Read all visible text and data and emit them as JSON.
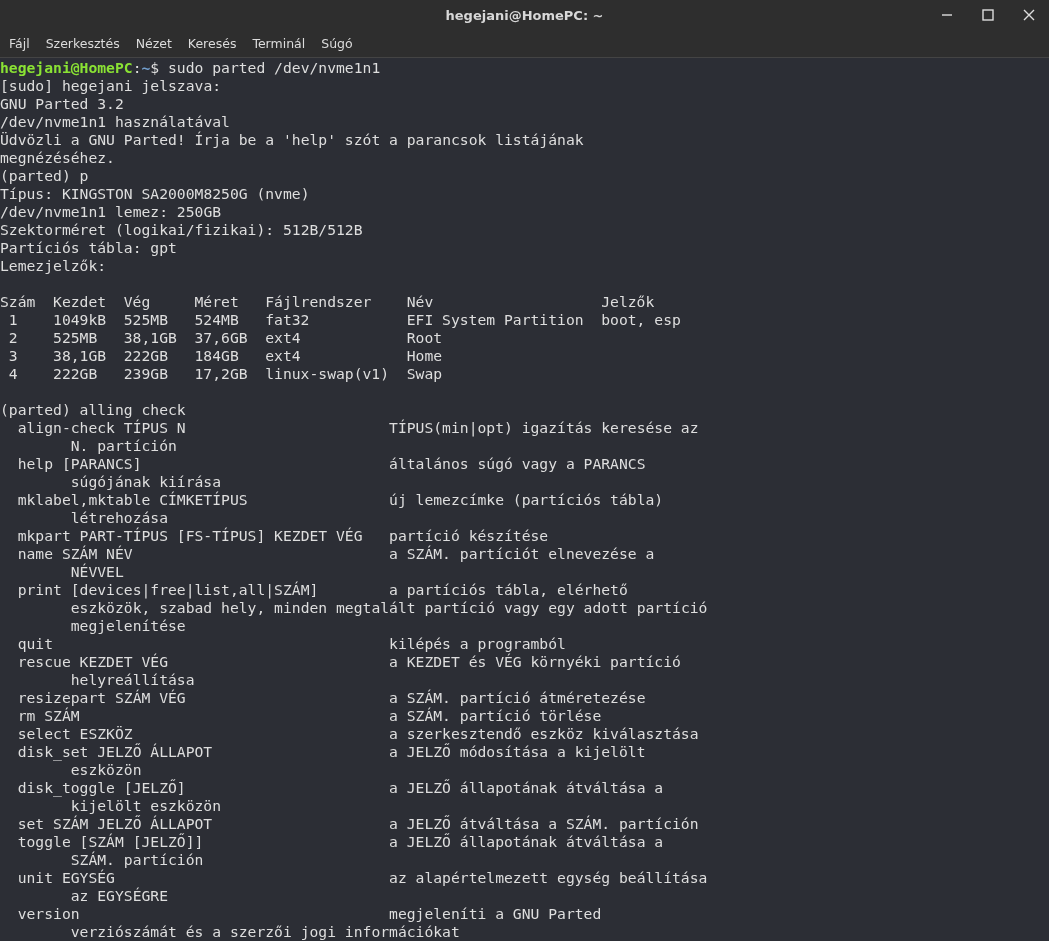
{
  "window": {
    "title": "hegejani@HomePC: ~"
  },
  "menu": [
    "Fájl",
    "Szerkesztés",
    "Nézet",
    "Keresés",
    "Terminál",
    "Súgó"
  ],
  "terminal": {
    "prompt": {
      "user_host": "hegejani@HomePC",
      "separator": ":",
      "path": "~",
      "command": "$ sudo parted /dev/nvme1n1"
    },
    "intro_lines": [
      "[sudo] hegejani jelszava:",
      "GNU Parted 3.2",
      "/dev/nvme1n1 használatával",
      "Üdvözli a GNU Parted! Írja be a 'help' szót a parancsok listájának",
      "megnézéséhez.",
      "(parted) p",
      "Típus: KINGSTON SA2000M8250G (nvme)",
      "/dev/nvme1n1 lemez: 250GB",
      "Szektorméret (logikai/fizikai): 512B/512B",
      "Partíciós tábla: gpt",
      "Lemezjelzők:"
    ],
    "table": {
      "columns": [
        "Szám",
        "Kezdet",
        "Vég",
        "Méret",
        "Fájlrendszer",
        "Név",
        "Jelzők"
      ],
      "rows": [
        [
          " 1",
          "1049kB",
          "525MB",
          "524MB",
          "fat32",
          "EFI System Partition",
          "boot, esp"
        ],
        [
          " 2",
          "525MB",
          "38,1GB",
          "37,6GB",
          "ext4",
          "Root"
        ],
        [
          " 3",
          "38,1GB",
          "222GB",
          "184GB",
          "ext4",
          "Home"
        ],
        [
          " 4",
          "222GB",
          "239GB",
          "17,2GB",
          "linux-swap(v1)",
          "Swap"
        ]
      ]
    },
    "second_command": "(parted) alling check",
    "help_entries": [
      {
        "command": "align-check TÍPUS N",
        "description": "TÍPUS(min|opt) igazítás keresése az",
        "continuation": "N. partíción"
      },
      {
        "command": "help [PARANCS]",
        "description": "általános súgó vagy a PARANCS",
        "continuation": "súgójának kiírása"
      },
      {
        "command": "mklabel,mktable CÍMKETÍPUS",
        "description": "új lemezcímke (partíciós tábla)",
        "continuation": "létrehozása"
      },
      {
        "command": "mkpart PART-TÍPUS [FS-TÍPUS] KEZDET VÉG",
        "description": "partíció készítése"
      },
      {
        "command": "name SZÁM NÉV",
        "description": "a SZÁM. partíciót elnevezése a",
        "continuation": "NÉVVEL"
      },
      {
        "command": "print [devices|free|list,all|SZÁM]",
        "description": "a partíciós tábla, elérhető",
        "continuation": "eszközök, szabad hely, minden megtalált partíció vagy egy adott partíció",
        "continuation_2": "megjelenítése"
      },
      {
        "command": "quit",
        "description": "kilépés a programból"
      },
      {
        "command": "rescue KEZDET VÉG",
        "description": "a KEZDET és VÉG környéki partíció",
        "continuation": "helyreállítása"
      },
      {
        "command": "resizepart SZÁM VÉG",
        "description": "a SZÁM. partíció átméretezése"
      },
      {
        "command": "rm SZÁM",
        "description": "a SZÁM. partíció törlése"
      },
      {
        "command": "select ESZKÖZ",
        "description": "a szerkesztendő eszköz kiválasztása"
      },
      {
        "command": "disk_set JELZŐ ÁLLAPOT",
        "description": "a JELZŐ módosítása a kijelölt",
        "continuation": "eszközön"
      },
      {
        "command": "disk_toggle [JELZŐ]",
        "description": "a JELZŐ állapotának átváltása a",
        "continuation": "kijelölt eszközön"
      },
      {
        "command": "set SZÁM JELZŐ ÁLLAPOT",
        "description": "a JELZŐ átváltása a SZÁM. partíción"
      },
      {
        "command": "toggle [SZÁM [JELZŐ]]",
        "description": "a JELZŐ állapotának átváltása a",
        "continuation": "SZÁM. partíción"
      },
      {
        "command": "unit EGYSÉG",
        "description": "az alapértelmezett egység beállítása",
        "continuation": "az EGYSÉGRE"
      },
      {
        "command": "version",
        "description": "megjeleníti a GNU Parted",
        "continuation": "verziószámát és a szerzői jogi információkat"
      }
    ]
  }
}
